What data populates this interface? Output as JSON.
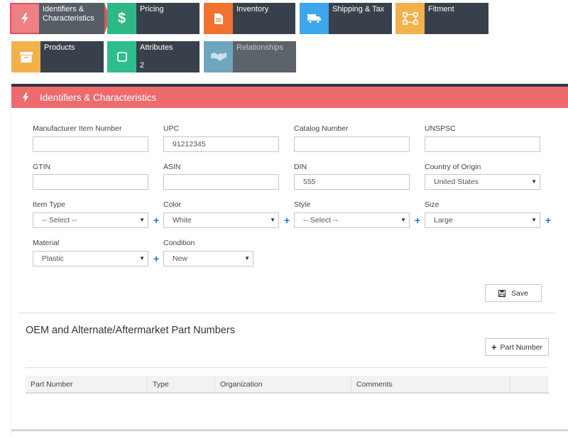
{
  "tiles": [
    {
      "label": "Identifiers & Characteristics",
      "color": "#e8505b",
      "icon": "lightning-icon",
      "state": "active"
    },
    {
      "label": "Pricing",
      "color": "#2eb886",
      "icon": "dollar-icon"
    },
    {
      "label": "Inventory",
      "color": "#f0722e",
      "icon": "document-icon"
    },
    {
      "label": "Shipping & Tax",
      "color": "#3ea6ec",
      "icon": "truck-icon"
    },
    {
      "label": "Fitment",
      "color": "#f2b14a",
      "icon": "fitment-icon"
    },
    {
      "label": "Products",
      "color": "#f2b14a",
      "icon": "box-icon"
    },
    {
      "label": "Attributes",
      "count": "2",
      "color": "#2ebd8d",
      "icon": "square-icon"
    },
    {
      "label": "Relationships",
      "color": "#6fa6bd",
      "icon": "handshake-icon",
      "state": "disabled"
    }
  ],
  "panel": {
    "title": "Identifiers & Characteristics",
    "fields": {
      "manufacturer_item_number": {
        "label": "Manufacturer Item Number",
        "value": ""
      },
      "upc": {
        "label": "UPC",
        "value": "91212345"
      },
      "catalog_number": {
        "label": "Catalog Number",
        "value": ""
      },
      "unspsc": {
        "label": "UNSPSC",
        "value": ""
      },
      "gtin": {
        "label": "GTIN",
        "value": ""
      },
      "asin": {
        "label": "ASIN",
        "value": ""
      },
      "din": {
        "label": "DIN",
        "value": "555"
      },
      "country_of_origin": {
        "label": "Country of Origin",
        "value": "United States"
      },
      "item_type": {
        "label": "Item Type",
        "value": "-- Select --"
      },
      "color": {
        "label": "Color",
        "value": "White"
      },
      "style": {
        "label": "Style",
        "value": "-- Select --"
      },
      "size": {
        "label": "Size",
        "value": "Large"
      },
      "material": {
        "label": "Material",
        "value": "Plastic"
      },
      "condition": {
        "label": "Condition",
        "value": "New"
      }
    },
    "save_label": "Save"
  },
  "part_numbers": {
    "title": "OEM and Alternate/Aftermarket Part Numbers",
    "add_label": "Part Number",
    "columns": [
      "Part Number",
      "Type",
      "Organization",
      "Comments"
    ]
  }
}
